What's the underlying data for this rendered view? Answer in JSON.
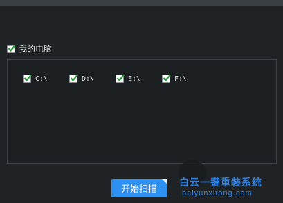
{
  "root": {
    "label": "我的电脑",
    "checked": true
  },
  "drives": [
    {
      "label": "C:\\",
      "checked": true
    },
    {
      "label": "D:\\",
      "checked": true
    },
    {
      "label": "E:\\",
      "checked": true
    },
    {
      "label": "F:\\",
      "checked": true
    }
  ],
  "actions": {
    "scan_label": "开始扫描"
  },
  "watermark": {
    "text_cn": "白云一键重装系统",
    "text_en": "baiyunxitong.com"
  },
  "colors": {
    "accent": "#2e90f0",
    "check": "#2b9a3a",
    "background": "#1f2326"
  }
}
